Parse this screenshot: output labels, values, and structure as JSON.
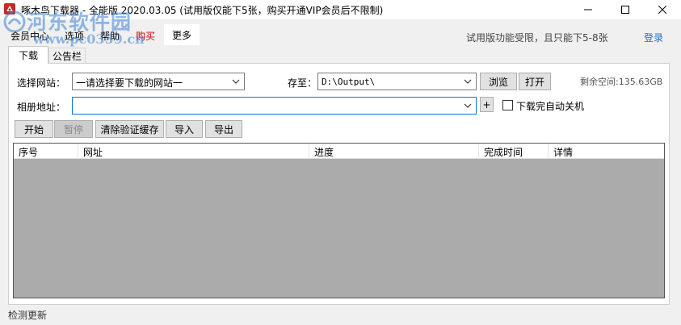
{
  "window": {
    "title": "啄木鸟下载器 - 全能版 2020.03.05 (试用版仅能下5张，购买开通VIP会员后不限制)"
  },
  "watermark": {
    "title": "河东软件园",
    "url": "www.pc0359.cn"
  },
  "menu": {
    "items": [
      "会员中心",
      "选项",
      "帮助",
      "购买",
      "更多"
    ],
    "buy_color": "#d00000"
  },
  "trial_note": "试用版功能受限，且只能下5-8张",
  "login": "登录",
  "tabs": [
    "下载",
    "公告栏"
  ],
  "form": {
    "site_label": "选择网站：",
    "site_value": "一请选择要下载的网站一",
    "save_label": "存至：",
    "save_value": "D:\\Output\\",
    "browse": "浏览",
    "open": "打开",
    "free_space": "剩余空间:135.63GB",
    "album_label": "相册地址：",
    "album_value": "",
    "plus": "+",
    "shutdown_label": "下载完自动关机",
    "shutdown_checked": false
  },
  "actions": {
    "start": "开始",
    "pause": "暂停",
    "clear_cache": "清除验证缓存",
    "import": "导入",
    "export": "导出"
  },
  "table": {
    "columns": [
      "序号",
      "网址",
      "进度",
      "完成时间",
      "详情"
    ],
    "rows": []
  },
  "status": "检测更新",
  "colors": {
    "accent": "#0078d7",
    "login_link": "#1e6fd0",
    "table_empty": "#ababab"
  }
}
